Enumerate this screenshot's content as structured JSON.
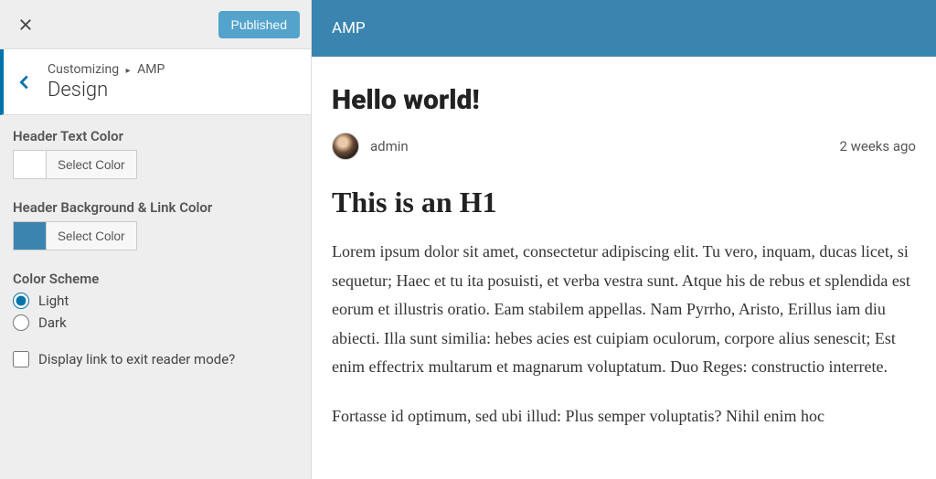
{
  "sidebar": {
    "publish_label": "Published",
    "breadcrumb_parent": "Customizing",
    "breadcrumb_child": "AMP",
    "section_title": "Design",
    "fields": {
      "header_text_color": {
        "label": "Header Text Color",
        "button": "Select Color",
        "value": "#ffffff"
      },
      "header_bg_color": {
        "label": "Header Background & Link Color",
        "button": "Select Color",
        "value": "#3a85b0"
      },
      "color_scheme": {
        "label": "Color Scheme",
        "options": {
          "light": "Light",
          "dark": "Dark"
        },
        "selected": "light"
      },
      "exit_reader": {
        "label": "Display link to exit reader mode?",
        "checked": false
      }
    }
  },
  "preview": {
    "header_title": "AMP",
    "post_title": "Hello world!",
    "author": "admin",
    "date": "2 weeks ago",
    "content_h1": "This is an H1",
    "content_p1": "Lorem ipsum dolor sit amet, consectetur adipiscing elit. Tu vero, inquam, ducas licet, si sequetur; Haec et tu ita posuisti, et verba vestra sunt. Atque his de rebus et splendida est eorum et illustris oratio. Eam stabilem appellas. Nam Pyrrho, Aristo, Erillus iam diu abiecti. Illa sunt similia: hebes acies est cuipiam oculorum, corpore alius senescit; Est enim effectrix multarum et magnarum voluptatum. Duo Reges: constructio interrete.",
    "content_p2": "Fortasse id optimum, sed ubi illud: Plus semper voluptatis? Nihil enim hoc"
  }
}
